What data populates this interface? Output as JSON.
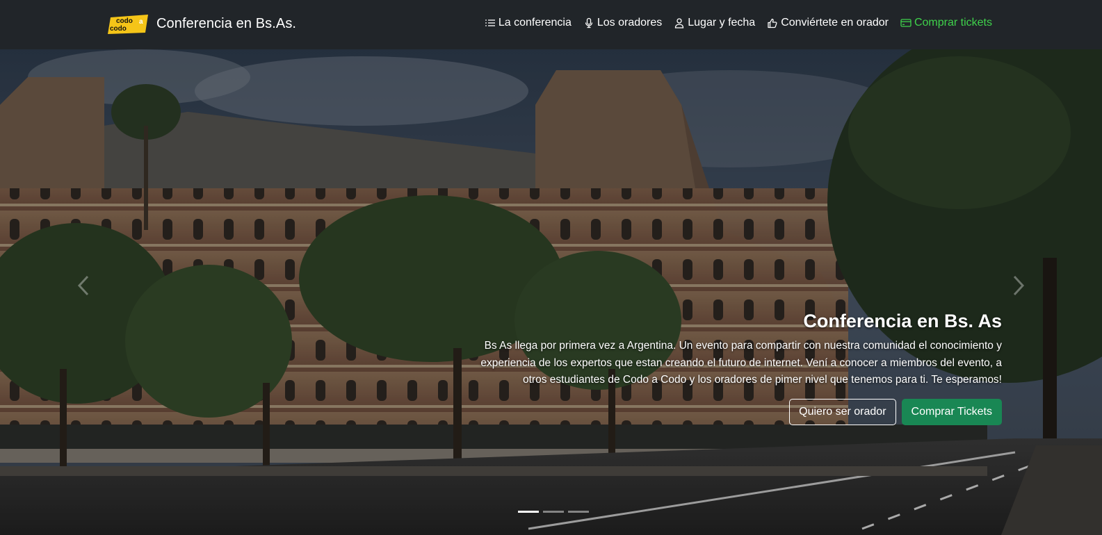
{
  "header": {
    "logo_text_top": "codo",
    "logo_text_bottom": "codo",
    "logo_text_a": "a",
    "title": "Conferencia en Bs.As."
  },
  "nav": {
    "items": [
      {
        "label": "La conferencia",
        "icon": "list-icon"
      },
      {
        "label": "Los oradores",
        "icon": "microphone-icon"
      },
      {
        "label": "Lugar y fecha",
        "icon": "person-icon"
      },
      {
        "label": "Conviértete en orador",
        "icon": "thumbs-up-icon"
      },
      {
        "label": "Comprar tickets",
        "icon": "credit-card-icon"
      }
    ],
    "tickets_color": "#3fd24b"
  },
  "hero": {
    "title": "Conferencia en Bs. As",
    "description": "Bs As llega por primera vez a Argentina. Un evento para compartir con nuestra comunidad el conocimiento y experiencia de los expertos que estan creando el futuro de internet. Vení a conocer a miembros del evento, a otros estudiantes de Codo a Codo y los oradores de pimer nivel que tenemos para ti. Te esperamos!",
    "btn_speaker": "Quiero ser orador",
    "btn_tickets": "Comprar Tickets",
    "active_slide": 1,
    "slide_count": 3
  },
  "colors": {
    "navbar_bg": "#212529",
    "success": "#198754",
    "logo_yellow": "#f5c518"
  }
}
